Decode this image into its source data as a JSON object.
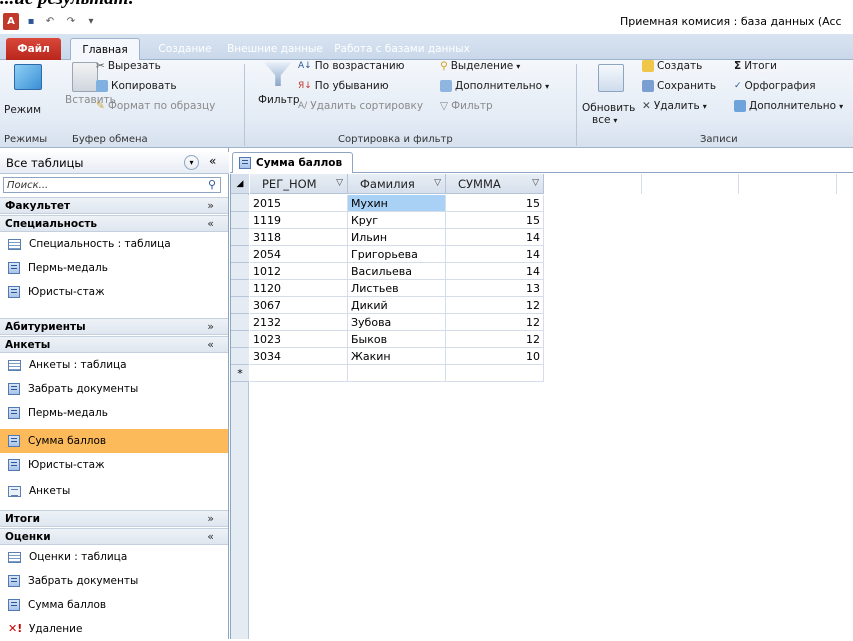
{
  "page_heading_fragment": "...ие результат:",
  "window": {
    "title": "Приемная комисия : база данных (Acc",
    "app_icon": "access-icon",
    "quick_access": [
      "save-icon",
      "undo-icon",
      "redo-icon",
      "customize-icon"
    ]
  },
  "ribbon_tabs": [
    {
      "label": "Файл",
      "active": false,
      "file": true
    },
    {
      "label": "Главная",
      "active": true
    },
    {
      "label": "Создание",
      "active": false
    },
    {
      "label": "Внешние данные",
      "active": false
    },
    {
      "label": "Работа с базами данных",
      "active": false
    }
  ],
  "ribbon": {
    "views": {
      "mode_label": "Режим",
      "group": "Режимы"
    },
    "clipboard": {
      "paste": "Вставить",
      "cut": "Вырезать",
      "copy": "Копировать",
      "format_painter": "Формат по образцу",
      "group": "Буфер обмена"
    },
    "sort_filter": {
      "filter": "Фильтр",
      "ascending": "По возрастанию",
      "descending": "По убыванию",
      "remove_sort": "Удалить сортировку",
      "selection": "Выделение",
      "advanced": "Дополнительно",
      "toggle_filter": "Фильтр",
      "group": "Сортировка и фильтр"
    },
    "records": {
      "refresh_all": "Обновить",
      "refresh_all_2": "все",
      "new": "Создать",
      "save": "Сохранить",
      "delete": "Удалить",
      "totals": "Итоги",
      "spelling": "Орфография",
      "more": "Дополнительно",
      "group": "Записи"
    }
  },
  "nav": {
    "header": "Все таблицы",
    "search_placeholder": "Поиск...",
    "sections": [
      {
        "title": "Факультет",
        "expanded": false,
        "items": []
      },
      {
        "title": "Специальность",
        "expanded": true,
        "items": [
          {
            "label": "Специальность : таблица",
            "icon": "table-icon"
          },
          {
            "label": "Пермь-медаль",
            "icon": "query-icon"
          },
          {
            "label": "Юристы-стаж",
            "icon": "query-icon"
          }
        ]
      },
      {
        "title": "Абитуриенты",
        "expanded": false,
        "items": []
      },
      {
        "title": "Анкеты",
        "expanded": true,
        "items": [
          {
            "label": "Анкеты : таблица",
            "icon": "table-icon"
          },
          {
            "label": "Забрать документы",
            "icon": "query-icon"
          },
          {
            "label": "Пермь-медаль",
            "icon": "query-icon"
          },
          {
            "label": "Сумма баллов",
            "icon": "query-icon",
            "selected": true
          },
          {
            "label": "Юристы-стаж",
            "icon": "query-icon"
          },
          {
            "label": "Анкеты",
            "icon": "form-icon"
          }
        ]
      },
      {
        "title": "Итоги",
        "expanded": false,
        "items": []
      },
      {
        "title": "Оценки",
        "expanded": true,
        "items": [
          {
            "label": "Оценки : таблица",
            "icon": "table-icon"
          },
          {
            "label": "Забрать документы",
            "icon": "query-icon"
          },
          {
            "label": "Сумма баллов",
            "icon": "query-icon"
          },
          {
            "label": "Удаление",
            "icon": "delete-query-icon"
          }
        ]
      }
    ]
  },
  "document_tab": "Сумма баллов",
  "datasheet": {
    "columns": [
      "РЕГ_НОМ",
      "Фамилия",
      "СУММА"
    ],
    "rows": [
      [
        "2015",
        "Мухин",
        "15"
      ],
      [
        "1119",
        "Круг",
        "15"
      ],
      [
        "3118",
        "Ильин",
        "14"
      ],
      [
        "2054",
        "Григорьева",
        "14"
      ],
      [
        "1012",
        "Васильева",
        "14"
      ],
      [
        "1120",
        "Листьев",
        "13"
      ],
      [
        "3067",
        "Дикий",
        "12"
      ],
      [
        "2132",
        "Зубова",
        "12"
      ],
      [
        "1023",
        "Быков",
        "12"
      ],
      [
        "3034",
        "Жакин",
        "10"
      ]
    ],
    "new_row_marker": "*",
    "selected_cell": {
      "row": 0,
      "col": 1
    }
  }
}
